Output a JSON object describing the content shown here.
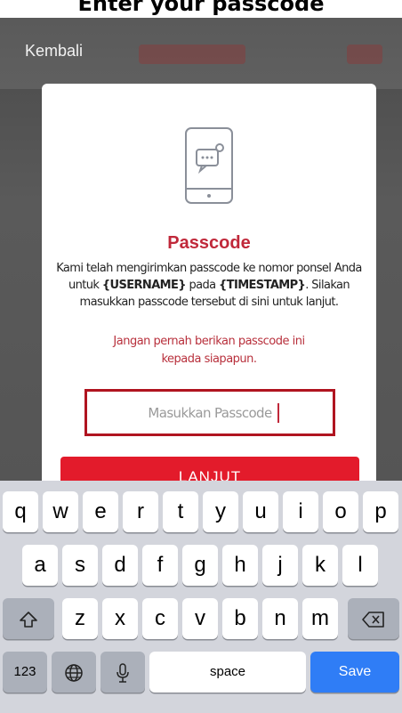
{
  "header": {
    "title": "Enter your passcode"
  },
  "nav": {
    "back_label": "Kembali"
  },
  "dialog": {
    "title": "Passcode",
    "body_part1": "Kami telah mengirimkan passcode ke nomor ponsel Anda untuk ",
    "username_token": "{USERNAME}",
    "body_part2": " pada ",
    "timestamp_token": "{TIMESTAMP}",
    "body_part3": ". Silakan masukkan passcode tersebut di sini untuk lanjut.",
    "warning_line1": "Jangan pernah berikan passcode ini",
    "warning_line2": "kepada siapapun.",
    "passcode_placeholder": "Masukkan Passcode",
    "submit_label": "LANJUT"
  },
  "keyboard": {
    "row1": [
      "q",
      "w",
      "e",
      "r",
      "t",
      "y",
      "u",
      "i",
      "o",
      "p"
    ],
    "row2": [
      "a",
      "s",
      "d",
      "f",
      "g",
      "h",
      "j",
      "k",
      "l"
    ],
    "row3": [
      "z",
      "x",
      "c",
      "v",
      "b",
      "n",
      "m"
    ],
    "numbers_label": "123",
    "space_label": "space",
    "return_label": "Save",
    "icons": [
      "shift-icon",
      "delete-icon",
      "globe-icon",
      "microphone-icon"
    ]
  },
  "colors": {
    "accent_red": "#e31b2b",
    "title_red": "#c0283a",
    "highlight_border": "#b01420",
    "save_blue": "#2f7df6"
  }
}
